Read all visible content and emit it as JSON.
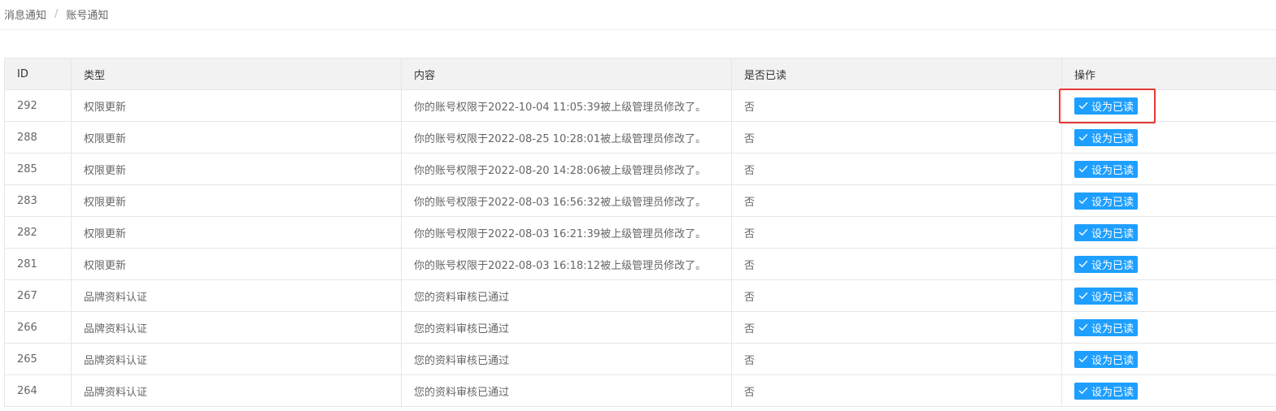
{
  "breadcrumb": {
    "items": [
      "消息通知",
      "账号通知"
    ],
    "separator": "/"
  },
  "table": {
    "columns": [
      "ID",
      "类型",
      "内容",
      "是否已读",
      "操作"
    ],
    "rows": [
      {
        "id": "292",
        "type": "权限更新",
        "content": "你的账号权限于2022-10-04 11:05:39被上级管理员修改了。",
        "read": "否",
        "action": "设为已读"
      },
      {
        "id": "288",
        "type": "权限更新",
        "content": "你的账号权限于2022-08-25 10:28:01被上级管理员修改了。",
        "read": "否",
        "action": "设为已读"
      },
      {
        "id": "285",
        "type": "权限更新",
        "content": "你的账号权限于2022-08-20 14:28:06被上级管理员修改了。",
        "read": "否",
        "action": "设为已读"
      },
      {
        "id": "283",
        "type": "权限更新",
        "content": "你的账号权限于2022-08-03 16:56:32被上级管理员修改了。",
        "read": "否",
        "action": "设为已读"
      },
      {
        "id": "282",
        "type": "权限更新",
        "content": "你的账号权限于2022-08-03 16:21:39被上级管理员修改了。",
        "read": "否",
        "action": "设为已读"
      },
      {
        "id": "281",
        "type": "权限更新",
        "content": "你的账号权限于2022-08-03 16:18:12被上级管理员修改了。",
        "read": "否",
        "action": "设为已读"
      },
      {
        "id": "267",
        "type": "品牌资料认证",
        "content": "您的资料审核已通过",
        "read": "否",
        "action": "设为已读"
      },
      {
        "id": "266",
        "type": "品牌资料认证",
        "content": "您的资料审核已通过",
        "read": "否",
        "action": "设为已读"
      },
      {
        "id": "265",
        "type": "品牌资料认证",
        "content": "您的资料审核已通过",
        "read": "否",
        "action": "设为已读"
      },
      {
        "id": "264",
        "type": "品牌资料认证",
        "content": "您的资料审核已通过",
        "read": "否",
        "action": "设为已读"
      }
    ]
  },
  "colors": {
    "button_bg": "#1e9fff",
    "highlight_border": "#e53935",
    "header_bg": "#f2f2f2"
  },
  "icons": {
    "button_icon": "check-icon"
  }
}
